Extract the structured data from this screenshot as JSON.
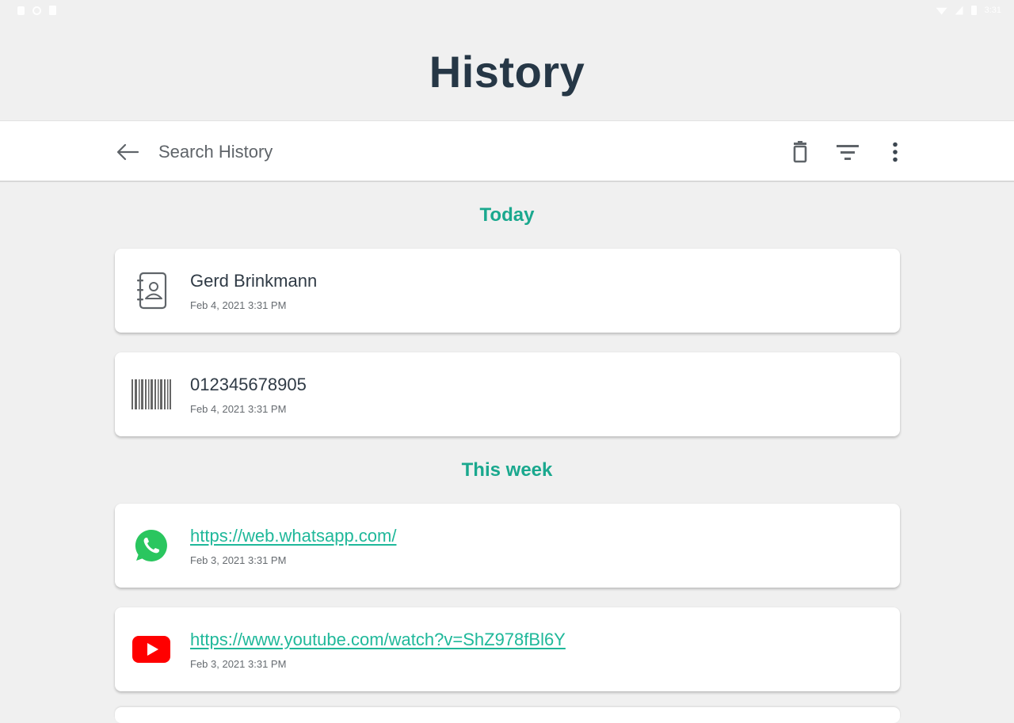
{
  "status_bar": {
    "time": "3:31"
  },
  "header": {
    "title": "History"
  },
  "toolbar": {
    "search_placeholder": "Search History",
    "icons": {
      "back": "arrow-left-icon",
      "delete": "trash-icon",
      "filter": "filter-icon",
      "more": "more-vert-icon"
    }
  },
  "sections": [
    {
      "title": "Today",
      "items": [
        {
          "title": "Gerd Brinkmann",
          "date": "Feb 4, 2021 3:31 PM",
          "icon": "contact-book-icon",
          "is_link": false
        },
        {
          "title": "012345678905",
          "date": "Feb 4, 2021 3:31 PM",
          "icon": "barcode-icon",
          "is_link": false
        }
      ]
    },
    {
      "title": "This week",
      "items": [
        {
          "title": "https://web.whatsapp.com/",
          "date": "Feb 3, 2021 3:31 PM",
          "icon": "whatsapp-icon",
          "is_link": true
        },
        {
          "title": "https://www.youtube.com/watch?v=ShZ978fBl6Y",
          "date": "Feb 3, 2021 3:31 PM",
          "icon": "youtube-icon",
          "is_link": true
        }
      ]
    }
  ],
  "colors": {
    "background": "#f0f0f0",
    "accent": "#1aa88e",
    "link": "#1fb89a",
    "title": "#263746",
    "whatsapp": "#25d366",
    "youtube": "#ff0000"
  }
}
